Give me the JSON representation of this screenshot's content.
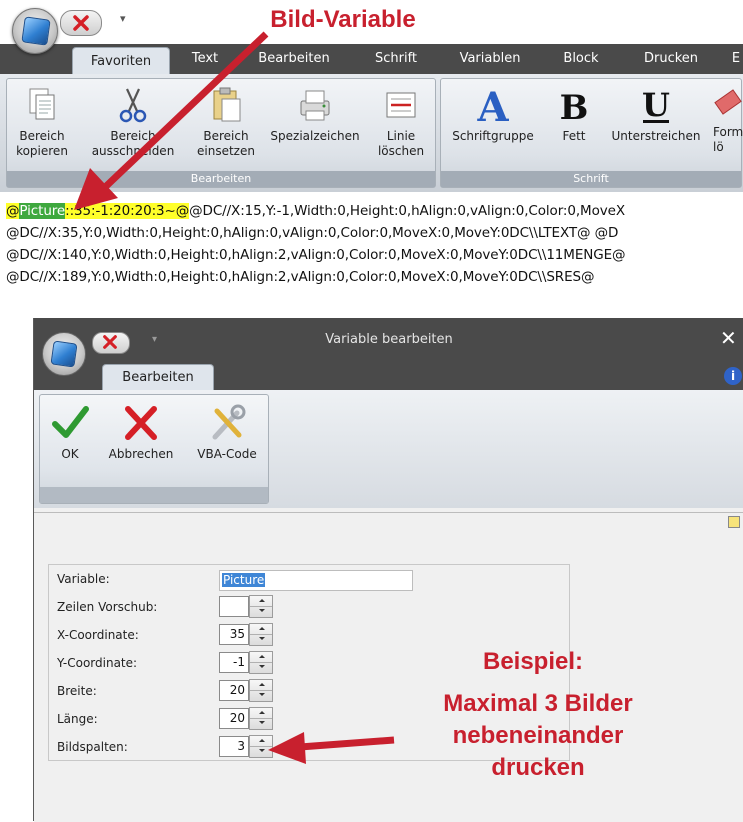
{
  "main_window": {
    "tabs": [
      "Favoriten",
      "Text",
      "Bearbeiten",
      "Schrift",
      "Variablen",
      "Block",
      "Drucken",
      "E"
    ],
    "active_tab": "Favoriten",
    "groups": [
      {
        "footer": "Bearbeiten",
        "buttons": [
          "Bereich\nkopieren",
          "Bereich\nausschneiden",
          "Bereich\neinsetzen",
          "Spezialzeichen",
          "Linie\nlöschen"
        ]
      },
      {
        "footer": "Schrift",
        "buttons": [
          "Schriftgruppe",
          "Fett",
          "Unterstreichen",
          "Form\nlö"
        ]
      }
    ]
  },
  "code_lines": {
    "line1": {
      "prefix": "@",
      "highlight": "Picture",
      "after_highlight": "::35:-1:20:20:3~@",
      "rest": "@DC//X:15,Y:-1,Width:0,Height:0,hAlign:0,vAlign:0,Color:0,MoveX"
    },
    "line2": "@DC//X:35,Y:0,Width:0,Height:0,hAlign:0,vAlign:0,Color:0,MoveX:0,MoveY:0DC\\\\LTEXT@ @D",
    "line3": "@DC//X:140,Y:0,Width:0,Height:0,hAlign:2,vAlign:0,Color:0,MoveX:0,MoveY:0DC\\\\11MENGE@",
    "line4": "@DC//X:189,Y:0,Width:0,Height:0,hAlign:2,vAlign:0,Color:0,MoveX:0,MoveY:0DC\\\\SRES@"
  },
  "annotations": {
    "bild_variable": "Bild-Variable",
    "beispiel_title": "Beispiel:",
    "beispiel_text": [
      "Maximal 3 Bilder",
      "nebeneinander",
      "drucken"
    ]
  },
  "dialog": {
    "title": "Variable bearbeiten",
    "close": "✕",
    "tab": "Bearbeiten",
    "info": "i",
    "buttons": [
      "OK",
      "Abbrechen",
      "VBA-Code"
    ],
    "fields": [
      {
        "label": "Variable:",
        "value": "Picture",
        "type": "text"
      },
      {
        "label": "Zeilen Vorschub:",
        "value": "",
        "type": "spin"
      },
      {
        "label": "X-Coordinate:",
        "value": "35",
        "type": "spin"
      },
      {
        "label": "Y-Coordinate:",
        "value": "-1",
        "type": "spin"
      },
      {
        "label": "Breite:",
        "value": "20",
        "type": "spin"
      },
      {
        "label": "Länge:",
        "value": "20",
        "type": "spin"
      },
      {
        "label": "Bildspalten:",
        "value": "3",
        "type": "spin"
      }
    ]
  },
  "colors": {
    "annotation_red": "#c8202e",
    "highlight_yellow": "#ffff2a",
    "highlight_green": "#3ea83e",
    "selection_blue": "#3f86d6",
    "tab_strip": "#4a4a4a"
  }
}
